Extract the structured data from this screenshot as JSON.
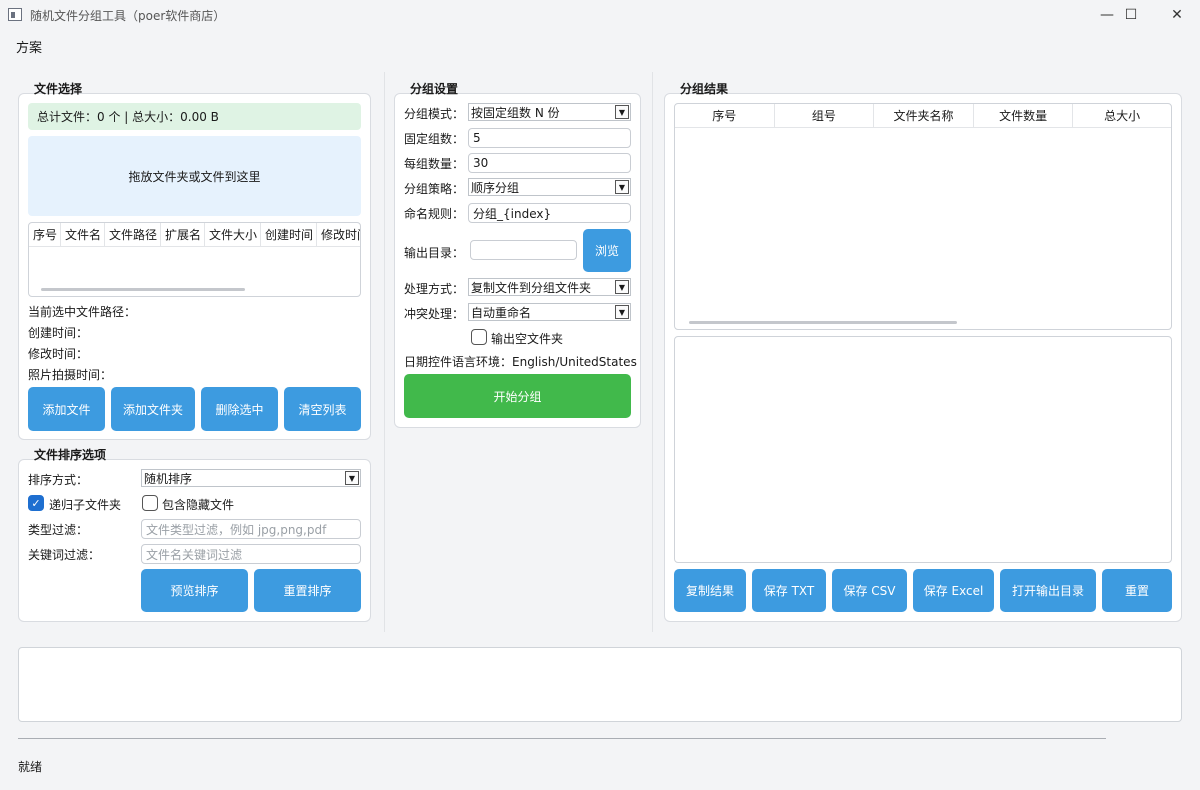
{
  "window": {
    "title": "随机文件分组工具（poer软件商店）",
    "minimize": "—",
    "maximize": "☐",
    "close": "✕"
  },
  "menu": {
    "scheme": "方案"
  },
  "file_select": {
    "title": "文件选择",
    "summary": "总计文件：0 个 | 总大小：0.00 B",
    "dropzone": "拖放文件夹或文件到这里",
    "columns": [
      "序号",
      "文件名",
      "文件路径",
      "扩展名",
      "文件大小",
      "创建时间",
      "修改时间"
    ],
    "selected_path_label": "当前选中文件路径：",
    "created_label": "创建时间：",
    "modified_label": "修改时间：",
    "photo_time_label": "照片拍摄时间：",
    "buttons": {
      "add_file": "添加文件",
      "add_folder": "添加文件夹",
      "delete_selected": "删除选中",
      "clear_list": "清空列表"
    }
  },
  "sort": {
    "title": "文件排序选项",
    "method_label": "排序方式：",
    "method_value": "随机排序",
    "recursive_label": "递归子文件夹",
    "recursive_checked": true,
    "hidden_label": "包含隐藏文件",
    "hidden_checked": false,
    "type_filter_label": "类型过滤：",
    "type_filter_placeholder": "文件类型过滤，例如 jpg,png,pdf",
    "keyword_filter_label": "关键词过滤：",
    "keyword_filter_placeholder": "文件名关键词过滤",
    "preview_button": "预览排序",
    "reset_button": "重置排序"
  },
  "group_settings": {
    "title": "分组设置",
    "mode_label": "分组模式：",
    "mode_value": "按固定组数 N 份",
    "fixed_groups_label": "固定组数：",
    "fixed_groups_value": "5",
    "per_group_label": "每组数量：",
    "per_group_value": "30",
    "strategy_label": "分组策略：",
    "strategy_value": "顺序分组",
    "naming_label": "命名规则：",
    "naming_value": "分组_{index}",
    "output_label": "输出目录：",
    "output_value": "",
    "browse_button": "浏览",
    "process_label": "处理方式：",
    "process_value": "复制文件到分组文件夹",
    "conflict_label": "冲突处理：",
    "conflict_value": "自动重命名",
    "empty_folder_label": "输出空文件夹",
    "empty_folder_checked": false,
    "locale_label": "日期控件语言环境：English/UnitedStates",
    "start_button": "开始分组"
  },
  "group_result": {
    "title": "分组结果",
    "columns": [
      "序号",
      "组号",
      "文件夹名称",
      "文件数量",
      "总大小"
    ],
    "buttons": {
      "copy": "复制结果",
      "save_txt": "保存 TXT",
      "save_csv": "保存 CSV",
      "save_excel": "保存 Excel",
      "open_output": "打开输出目录",
      "reset": "重置"
    }
  },
  "status": {
    "text": "就绪"
  }
}
